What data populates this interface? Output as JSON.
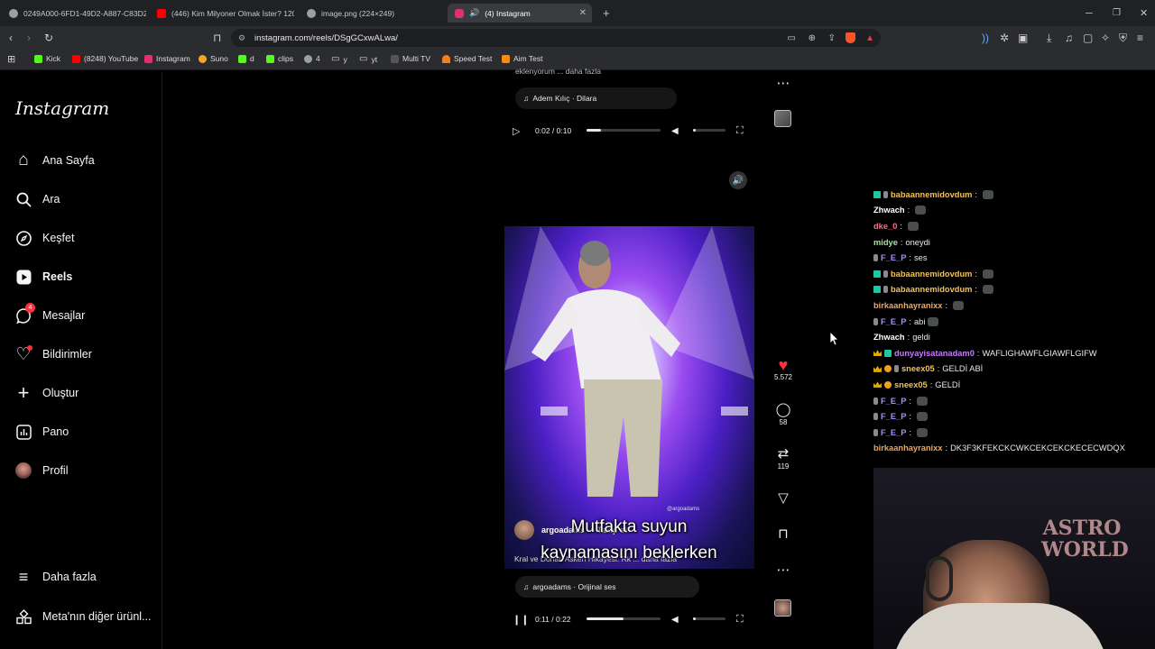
{
  "browser": {
    "tabs": [
      {
        "label": "0249A000-6FD1-49D2-A887-C83D2",
        "icon_color": "#9aa0a6",
        "active": false
      },
      {
        "label": "(446) Kim Milyoner Olmak İster? 120",
        "icon_color": "#ff0000",
        "active": false
      },
      {
        "label": "image.png (224×249)",
        "icon_color": "#9aa0a6",
        "active": false
      },
      {
        "label": "(4) Instagram",
        "icon_color": "#e1306c",
        "active": true
      }
    ],
    "new_tab": "+",
    "url": "instagram.com/reels/DSgGCxwALwa/",
    "bookmarks": [
      {
        "label": "Kick",
        "color": "#53fc18"
      },
      {
        "label": "(8248) YouTube",
        "color": "#ff0000"
      },
      {
        "label": "Instagram",
        "color": "#e1306c"
      },
      {
        "label": "Suno",
        "color": "#f5a623"
      },
      {
        "label": "d",
        "color": "#53fc18"
      },
      {
        "label": "clips",
        "color": "#53fc18"
      },
      {
        "label": "4",
        "color": "#9aa0a6"
      },
      {
        "label": "y",
        "color": "#9aa0a6"
      },
      {
        "label": "yt",
        "color": "#9aa0a6"
      },
      {
        "label": "Multi TV",
        "color": "#9aa0a6"
      },
      {
        "label": "Speed Test",
        "color": "#f38020"
      },
      {
        "label": "Aim Test",
        "color": "#ff8c00"
      }
    ]
  },
  "sidebar": {
    "logo": "Instagram",
    "items": [
      {
        "label": "Ana Sayfa",
        "icon": "home-icon",
        "glyph": "⌂"
      },
      {
        "label": "Ara",
        "icon": "search-icon",
        "glyph": "⚲"
      },
      {
        "label": "Keşfet",
        "icon": "compass-icon",
        "glyph": "◎"
      },
      {
        "label": "Reels",
        "icon": "reels-icon",
        "glyph": "▶"
      },
      {
        "label": "Mesajlar",
        "icon": "messenger-icon",
        "glyph": "✈",
        "badge": "4"
      },
      {
        "label": "Bildirimler",
        "icon": "heart-icon",
        "glyph": "♡"
      },
      {
        "label": "Oluştur",
        "icon": "plus-icon",
        "glyph": "+"
      },
      {
        "label": "Pano",
        "icon": "dashboard-icon",
        "glyph": "▤"
      },
      {
        "label": "Profil",
        "icon": "profile-avatar-icon",
        "glyph": "●"
      }
    ],
    "more": "Daha fazla",
    "meta": "Meta'nın diğer ürünl..."
  },
  "reel1": {
    "caption_fragment": "eklenyorum ... daha fazla",
    "audio": "Adem Kılıç · Dilara",
    "time": "0:02 / 0:10",
    "progress": 0.2
  },
  "reel2": {
    "subtitle_line1": "Mutfakta suyun",
    "subtitle_line2": "kaynamasını beklerken",
    "watermark": "@argoadams",
    "creator": "argoadams",
    "follow": "• Takip et",
    "caption": "Kral ve Dohan Askeri Hikayesi. Rk ... daha fazla",
    "audio": "argoadams · Orijinal ses",
    "time": "0:11 / 0:22",
    "progress": 0.5,
    "likes": "5.572",
    "comments": "58",
    "reposts": "119"
  },
  "chat": [
    {
      "badges": [
        "b1",
        "b2"
      ],
      "user": "babaannemidovdum",
      "color": "#f0c35a",
      "text": "",
      "emote": true
    },
    {
      "badges": [],
      "user": "Zhwach",
      "color": "#ffffff",
      "text": "",
      "emote": true
    },
    {
      "badges": [],
      "user": "dke_0",
      "color": "#ff6b8a",
      "text": "",
      "emote": true
    },
    {
      "badges": [],
      "user": "midye",
      "color": "#9ee6a0",
      "text": "oneydi",
      "emote": false
    },
    {
      "badges": [
        "b2"
      ],
      "user": "F_E_P",
      "color": "#a98bff",
      "text": "ses",
      "emote": false
    },
    {
      "badges": [
        "b1",
        "b2"
      ],
      "user": "babaannemidovdum",
      "color": "#f0c35a",
      "text": "",
      "emote": true
    },
    {
      "badges": [
        "b1",
        "b2"
      ],
      "user": "babaannemidovdum",
      "color": "#f0c35a",
      "text": "",
      "emote": true
    },
    {
      "badges": [],
      "user": "birkaanhayranixx",
      "color": "#f0a85a",
      "text": "",
      "emote": true
    },
    {
      "badges": [
        "b2"
      ],
      "user": "F_E_P",
      "color": "#a98bff",
      "text": "abi",
      "emote": true
    },
    {
      "badges": [],
      "user": "Zhwach",
      "color": "#ffffff",
      "text": "geldi",
      "emote": false
    },
    {
      "badges": [
        "b3",
        "b1"
      ],
      "user": "dunyayisatanadam0",
      "color": "#c77dff",
      "text": "WAFLIGHAWFLGIAWFLGIFW",
      "emote": false
    },
    {
      "badges": [
        "b3",
        "b4",
        "b2"
      ],
      "user": "sneex05",
      "color": "#f0c35a",
      "text": "GELDİ ABİ",
      "emote": false
    },
    {
      "badges": [
        "b3",
        "b4"
      ],
      "user": "sneex05",
      "color": "#f0c35a",
      "text": "GELDİ",
      "emote": false
    },
    {
      "badges": [
        "b2"
      ],
      "user": "F_E_P",
      "color": "#a98bff",
      "text": "",
      "emote": true
    },
    {
      "badges": [
        "b2"
      ],
      "user": "F_E_P",
      "color": "#a98bff",
      "text": "",
      "emote": true
    },
    {
      "badges": [
        "b2"
      ],
      "user": "F_E_P",
      "color": "#a98bff",
      "text": "",
      "emote": true
    },
    {
      "badges": [],
      "user": "birkaanhayranixx",
      "color": "#f0a85a",
      "text": "DK3F3KFEKCKCWKCEKCEKCKECECWDQX",
      "emote": false
    }
  ],
  "webcam_sign": "ASTRO WORLD"
}
